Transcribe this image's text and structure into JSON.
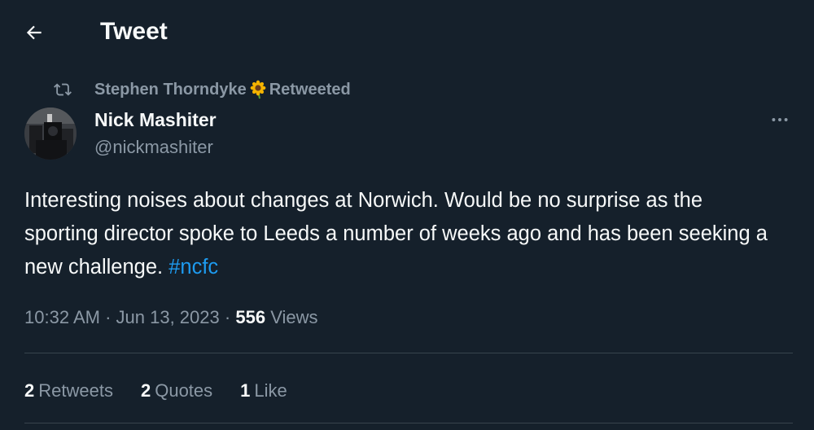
{
  "colors": {
    "background": "#15202b",
    "primary_text": "#f7f9f9",
    "secondary_text": "#8b98a5",
    "accent": "#1d9bf0",
    "divider": "#38444d"
  },
  "header": {
    "back_icon": "arrow-left-icon",
    "title": "Tweet"
  },
  "retweet_context": {
    "icon": "retweet-icon",
    "name": "Stephen Thorndyke",
    "emoji": "sunflower-icon",
    "label": "Retweeted"
  },
  "author": {
    "avatar_icon": "avatar-photo",
    "name": "Nick Mashiter",
    "handle": "@nickmashiter",
    "more_icon": "more-horizontal-icon"
  },
  "tweet": {
    "text": "Interesting noises about changes at Norwich. Would be no surprise as the sporting director spoke to Leeds a number of weeks ago and has been seeking a new challenge.",
    "hashtag": "#ncfc"
  },
  "meta": {
    "time": "10:32 AM",
    "separator": "·",
    "date": "Jun 13, 2023",
    "views_count": "556",
    "views_label": "Views"
  },
  "stats": {
    "retweets_count": "2",
    "retweets_label": "Retweets",
    "quotes_count": "2",
    "quotes_label": "Quotes",
    "likes_count": "1",
    "likes_label": "Like"
  }
}
